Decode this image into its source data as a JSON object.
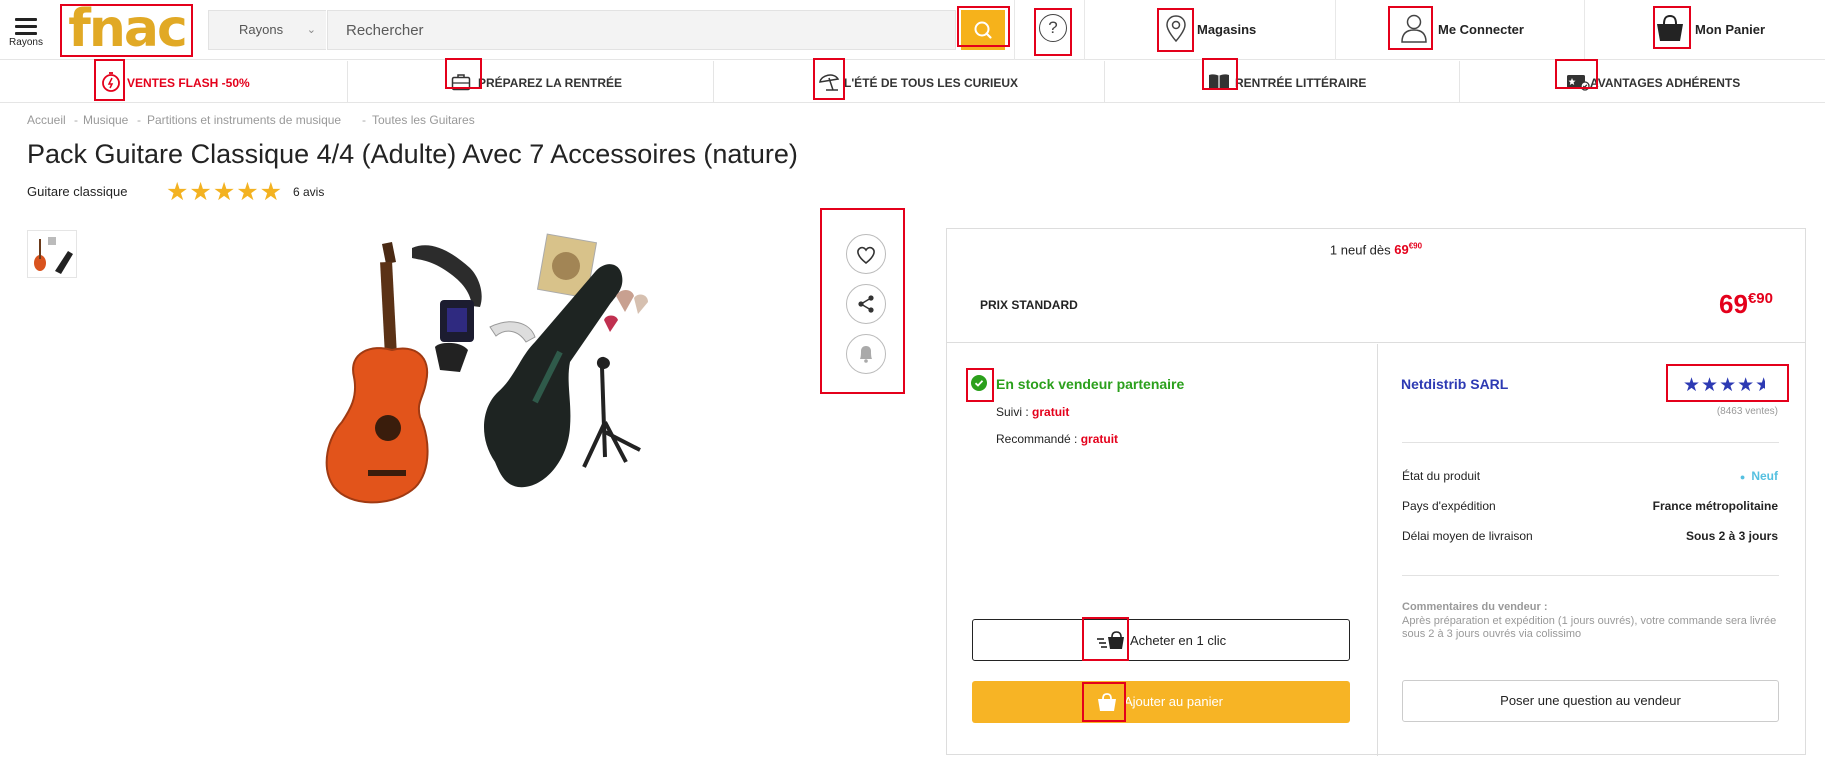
{
  "header": {
    "menu_label": "Rayons",
    "logo_text": "fnac",
    "rayons_select": "Rayons",
    "search_placeholder": "Rechercher",
    "help_glyph": "?",
    "stores_label": "Magasins",
    "login_label": "Me Connecter",
    "cart_label": "Mon Panier",
    "icons": [
      "menu-icon",
      "search-icon",
      "help-icon",
      "location-pin-icon",
      "user-icon",
      "shopping-bag-icon"
    ]
  },
  "nav": {
    "items": [
      {
        "label": "VENTES FLASH -50%",
        "icon": "stopwatch-icon",
        "color": "#e4001b"
      },
      {
        "label": "PRÉPAREZ LA RENTRÉE",
        "icon": "briefcase-icon"
      },
      {
        "label": "L'ÉTÉ DE TOUS LES CURIEUX",
        "icon": "parasol-icon"
      },
      {
        "label": "RENTRÉE LITTÉRAIRE",
        "icon": "book-icon"
      },
      {
        "label": "AVANTAGES ADHÉRENTS",
        "icon": "member-card-icon"
      }
    ]
  },
  "breadcrumb": [
    "Accueil",
    "Musique",
    "Partitions et instruments de musique",
    "Toutes les Guitares"
  ],
  "breadcrumb_sep": "-",
  "product": {
    "title": "Pack Guitare Classique 4/4 (Adulte) Avec 7 Accessoires (nature)",
    "subcategory": "Guitare classique",
    "stars_glyph": "★★★★★",
    "rating": 5,
    "reviews": "6 avis",
    "actions": [
      "heart-icon",
      "share-icon",
      "bell-icon"
    ]
  },
  "offer": {
    "new_from_prefix": "1 neuf dès",
    "new_from_price_int": "69",
    "new_from_price_dec": "€90",
    "price_label": "PRIX STANDARD",
    "price_int": "69",
    "price_dec": "€90",
    "stock": "En stock vendeur partenaire",
    "suivi_label": "Suivi :",
    "suivi_value": "gratuit",
    "recommande_label": "Recommandé :",
    "recommande_value": "gratuit",
    "buy_one_click": "Acheter en 1 clic",
    "add_to_cart": "Ajouter au panier",
    "accent_color": "#e4001b",
    "button_color": "#f7b425",
    "stock_color": "#2ba01c"
  },
  "seller": {
    "name": "Netdistrib SARL",
    "stars_glyph": "★★★★",
    "half_star_glyph": "★",
    "rating": 4.5,
    "sales": "(8463 ventes)",
    "details": [
      {
        "label": "État du produit",
        "value": "Neuf"
      },
      {
        "label": "Pays d'expédition",
        "value": "France métropolitaine"
      },
      {
        "label": "Délai moyen de livraison",
        "value": "Sous 2 à 3 jours"
      }
    ],
    "state_dot": "●",
    "comments_title": "Commentaires du vendeur :",
    "comments_text": "Après préparation et expédition (1 jours ouvrés), votre commande sera livrée sous 2 à 3 jours ouvrés via colissimo",
    "ask_button": "Poser une question au vendeur"
  }
}
